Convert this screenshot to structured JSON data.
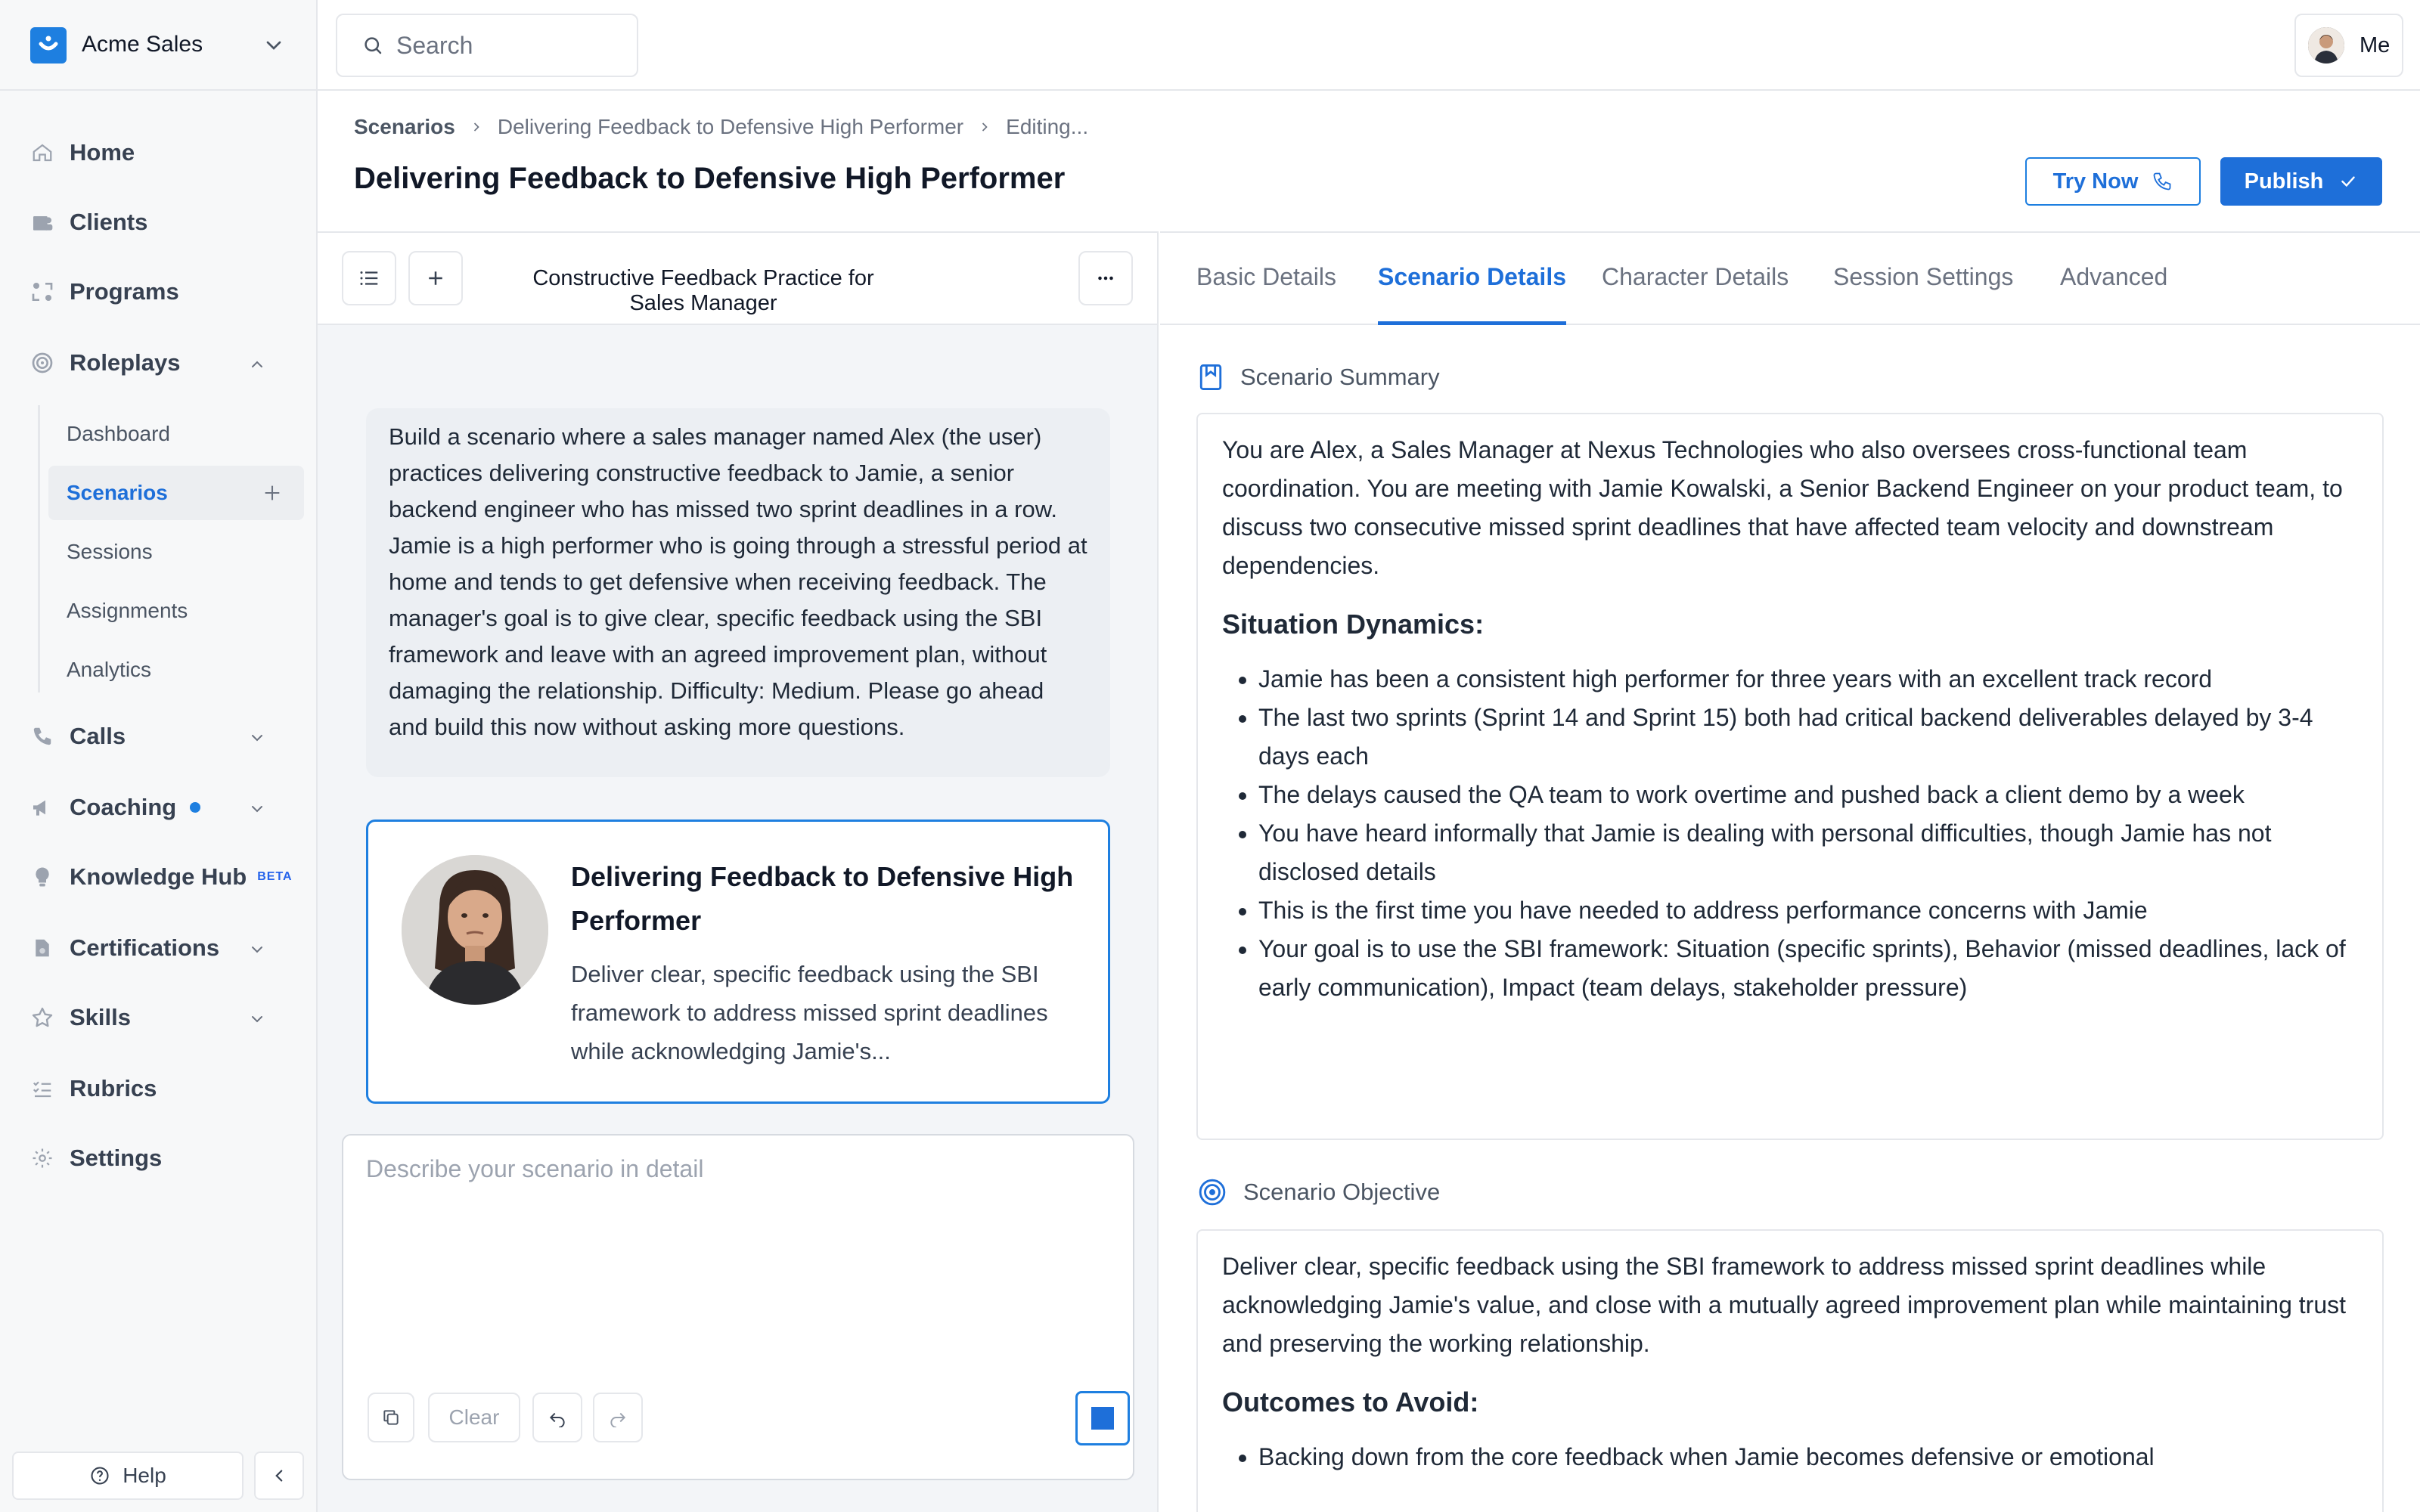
{
  "org": {
    "name": "Acme Sales"
  },
  "search": {
    "placeholder": "Search"
  },
  "user": {
    "label": "Me"
  },
  "nav": {
    "home": "Home",
    "clients": "Clients",
    "programs": "Programs",
    "roleplays": "Roleplays",
    "roleplays_sub": [
      "Dashboard",
      "Scenarios",
      "Sessions",
      "Assignments",
      "Analytics"
    ],
    "calls": "Calls",
    "coaching": "Coaching",
    "knowledge_hub": "Knowledge Hub",
    "knowledge_badge": "BETA",
    "certifications": "Certifications",
    "skills": "Skills",
    "rubrics": "Rubrics",
    "settings": "Settings",
    "help": "Help"
  },
  "breadcrumb": [
    "Scenarios",
    "Delivering Feedback to Defensive High Performer",
    "Editing..."
  ],
  "page_title": "Delivering Feedback to Defensive High Performer",
  "actions": {
    "try_now": "Try Now",
    "publish": "Publish"
  },
  "chat": {
    "title": "Constructive Feedback Practice for Sales Manager",
    "prompt": "Build a scenario where a sales manager named Alex (the user) practices delivering constructive feedback to Jamie, a senior backend engineer who has missed two sprint deadlines in a row. Jamie is a high performer who is going through a stressful period at home and tends to get defensive when receiving feedback. The manager's goal is to give clear, specific feedback using the SBI framework and leave with an agreed improvement plan, without damaging the relationship. Difficulty: Medium. Please go ahead and build this now without asking more questions.",
    "card_title": "Delivering Feedback to Defensive High Performer",
    "card_desc": "Deliver clear, specific feedback using the SBI framework to address missed sprint deadlines while acknowledging Jamie's...",
    "composer_placeholder": "Describe your scenario in detail",
    "clear": "Clear"
  },
  "tabs": [
    "Basic Details",
    "Scenario Details",
    "Character Details",
    "Session Settings",
    "Advanced"
  ],
  "active_tab": "Scenario Details",
  "summary": {
    "heading": "Scenario Summary",
    "intro": "You are Alex, a Sales Manager at Nexus Technologies who also oversees cross-functional team coordination. You are meeting with Jamie Kowalski, a Senior Backend Engineer on your product team, to discuss two consecutive missed sprint deadlines that have affected team velocity and downstream dependencies.",
    "subheading": "Situation Dynamics:",
    "bullets": [
      "Jamie has been a consistent high performer for three years with an excellent track record",
      "The last two sprints (Sprint 14 and Sprint 15) both had critical backend deliverables delayed by 3-4 days each",
      "The delays caused the QA team to work overtime and pushed back a client demo by a week",
      "You have heard informally that Jamie is dealing with personal difficulties, though Jamie has not disclosed details",
      "This is the first time you have needed to address performance concerns with Jamie",
      "Your goal is to use the SBI framework: Situation (specific sprints), Behavior (missed deadlines, lack of early communication), Impact (team delays, stakeholder pressure)"
    ]
  },
  "objective": {
    "heading": "Scenario Objective",
    "intro": "Deliver clear, specific feedback using the SBI framework to address missed sprint deadlines while acknowledging Jamie's value, and close with a mutually agreed improvement plan while maintaining trust and preserving the working relationship.",
    "subheading": "Outcomes to Avoid:",
    "bullets": [
      "Backing down from the core feedback when Jamie becomes defensive or emotional"
    ]
  },
  "colors": {
    "accent": "#1e6fd9",
    "sidebar_bg": "#f7f8f9",
    "chat_bg": "#f3f5f8"
  }
}
